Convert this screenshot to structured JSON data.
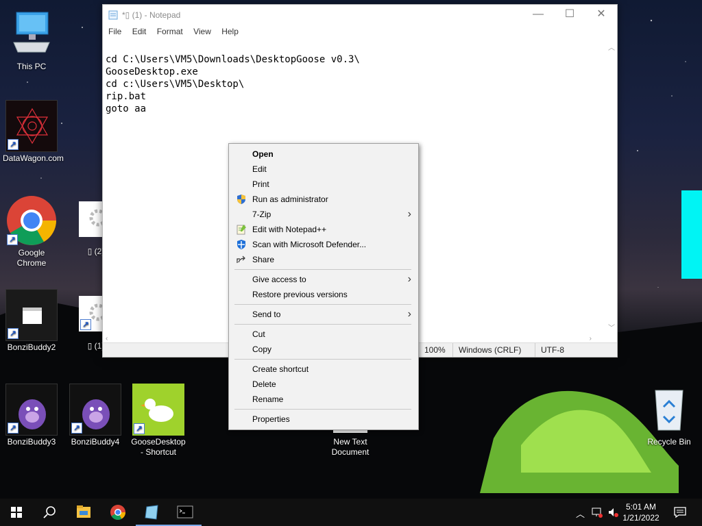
{
  "desktop": {
    "icons": [
      {
        "label": "This PC"
      },
      {
        "label": "DataWagon.com"
      },
      {
        "label": "Google Chrome"
      },
      {
        "label": "BonziBuddy2"
      },
      {
        "label": "BonziBuddy3"
      },
      {
        "label": "BonziBuddy4"
      },
      {
        "label": "GooseDesktop - Shortcut"
      },
      {
        "label": "▯ (2)"
      },
      {
        "label": "▯ (1)"
      },
      {
        "label": "New Text Document"
      },
      {
        "label": "Recycle Bin"
      }
    ]
  },
  "notepad": {
    "title": "*▯ (1) - Notepad",
    "menu": [
      "File",
      "Edit",
      "Format",
      "View",
      "Help"
    ],
    "content": "cd C:\\Users\\VM5\\Downloads\\DesktopGoose v0.3\\\nGooseDesktop.exe\ncd c:\\Users\\VM5\\Desktop\\\nrip.bat\ngoto aa",
    "status": {
      "zoom": "100%",
      "line_ending": "Windows (CRLF)",
      "encoding": "UTF-8"
    },
    "caption": {
      "minimize": "—",
      "maximize": "☐",
      "close": "✕"
    }
  },
  "context_menu": {
    "groups": [
      [
        {
          "label": "Open",
          "bold": true,
          "icon": ""
        },
        {
          "label": "Edit",
          "icon": ""
        },
        {
          "label": "Print",
          "icon": ""
        },
        {
          "label": "Run as administrator",
          "icon": "uac-shield-icon"
        },
        {
          "label": "7-Zip",
          "icon": "",
          "submenu": true
        },
        {
          "label": "Edit with Notepad++",
          "icon": "notepadpp-icon"
        },
        {
          "label": "Scan with Microsoft Defender...",
          "icon": "defender-icon"
        },
        {
          "label": "Share",
          "icon": "share-icon"
        }
      ],
      [
        {
          "label": "Give access to",
          "submenu": true
        },
        {
          "label": "Restore previous versions"
        }
      ],
      [
        {
          "label": "Send to",
          "submenu": true
        }
      ],
      [
        {
          "label": "Cut"
        },
        {
          "label": "Copy"
        }
      ],
      [
        {
          "label": "Create shortcut"
        },
        {
          "label": "Delete"
        },
        {
          "label": "Rename"
        }
      ],
      [
        {
          "label": "Properties"
        }
      ]
    ]
  },
  "taskbar": {
    "time": "5:01 AM",
    "date": "1/21/2022",
    "pinned": [
      "windows-start-icon",
      "search-icon",
      "file-explorer-icon",
      "chrome-icon",
      "notepad-icon",
      "cmd-icon"
    ]
  },
  "colors": {
    "accent_cyan": "#00f4f4",
    "taskbar": "#101010",
    "menu_bg": "#f2f2f2"
  }
}
